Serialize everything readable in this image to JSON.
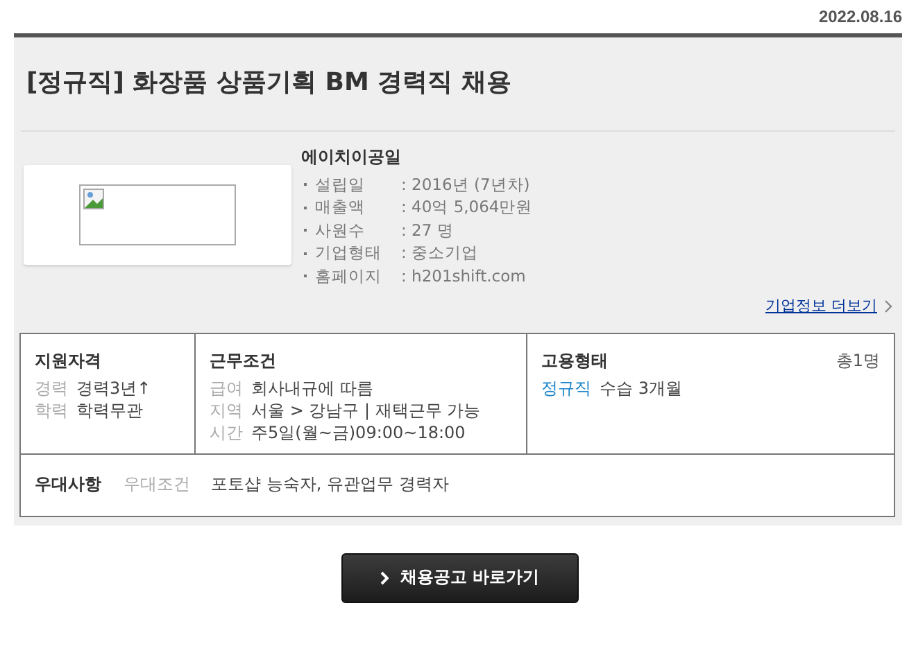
{
  "date": "2022.08.16",
  "title": "[정규직] 화장품 상품기획 BM 경력직 채용",
  "company": {
    "name": "에이치이공일",
    "info": [
      {
        "label": "설립일",
        "value": ": 2016년 (7년차)"
      },
      {
        "label": "매출액",
        "value": ": 40억 5,064만원"
      },
      {
        "label": "사원수",
        "value": ": 27 명"
      },
      {
        "label": "기업형태",
        "value": ": 중소기업"
      },
      {
        "label": "홈페이지",
        "value": ": h201shift.com"
      }
    ],
    "more_link": "기업정보 더보기"
  },
  "qualification": {
    "heading": "지원자격",
    "rows": [
      {
        "label": "경력",
        "value": "경력3년↑"
      },
      {
        "label": "학력",
        "value": "학력무관"
      }
    ]
  },
  "conditions": {
    "heading": "근무조건",
    "rows": [
      {
        "label": "급여",
        "value": "회사내규에 따름"
      },
      {
        "label": "지역",
        "value": "서울 > 강남구 | 재택근무 가능"
      },
      {
        "label": "시간",
        "value": "주5일(월~금)09:00~18:00"
      }
    ]
  },
  "employment": {
    "heading": "고용형태",
    "count": "총1명",
    "type": "정규직",
    "detail": "수습 3개월"
  },
  "preference": {
    "heading": "우대사항",
    "label": "우대조건",
    "value": "포토샵 능숙자, 유관업무 경력자"
  },
  "button": "채용공고 바로가기"
}
